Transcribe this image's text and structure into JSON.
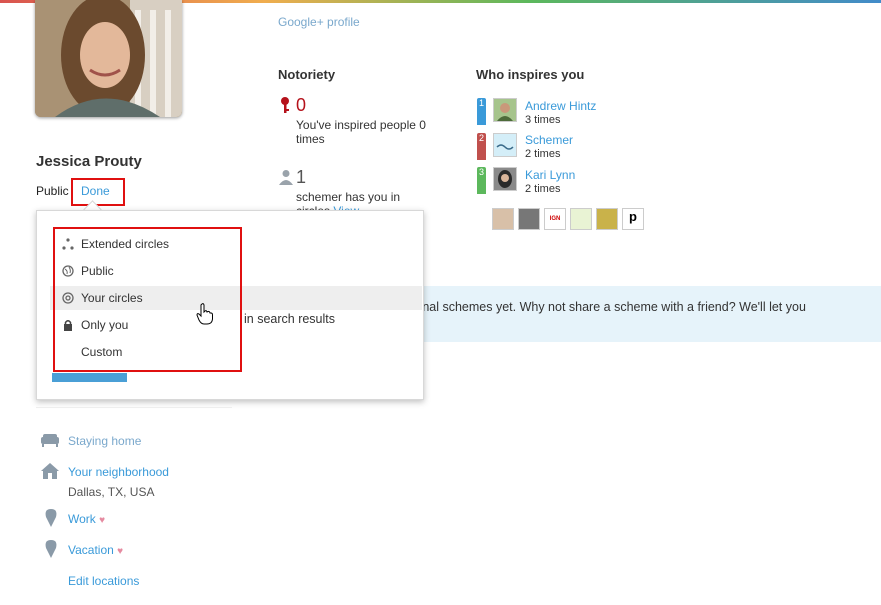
{
  "profile": {
    "google_plus_link": "Google+ profile",
    "name": "Jessica Prouty",
    "visibility_label": "Public",
    "done_link": "Done"
  },
  "visibility_menu": {
    "items": [
      {
        "label": "Extended circles",
        "icon": "extended-circles-icon"
      },
      {
        "label": "Public",
        "icon": "globe-icon"
      },
      {
        "label": "Your circles",
        "icon": "circles-icon"
      },
      {
        "label": "Only you",
        "icon": "lock-icon"
      },
      {
        "label": "Custom",
        "icon": ""
      }
    ],
    "hovered_index": 2,
    "behind_text": "in search results"
  },
  "notoriety": {
    "title": "Notoriety",
    "inspired_count": "0",
    "inspired_text": "You've inspired people 0 times",
    "circles_count": "1",
    "circles_text": "schemer has you in circles",
    "circles_link": "View"
  },
  "who_inspires": {
    "title": "Who inspires you",
    "people": [
      {
        "rank": "1",
        "name": "Andrew Hintz",
        "times": "3 times",
        "rank_color": "#3a9ad9"
      },
      {
        "rank": "2",
        "name": "Schemer",
        "times": "2 times",
        "rank_color": "#c0504d"
      },
      {
        "rank": "3",
        "name": "Kari Lynn",
        "times": "2 times",
        "rank_color": "#5cb85c"
      }
    ],
    "more_thumbs": [
      "avatar",
      "avatar",
      "IGN logo",
      "logo",
      "logo",
      "p logo"
    ]
  },
  "banner": {
    "text": "rational schemes yet. Why not share a scheme with a friend? We'll let you"
  },
  "locations": {
    "staying_home": "Staying home",
    "neighborhood": "Your neighborhood",
    "neighborhood_place": "Dallas, TX, USA",
    "work": "Work",
    "vacation": "Vacation",
    "edit": "Edit locations"
  }
}
